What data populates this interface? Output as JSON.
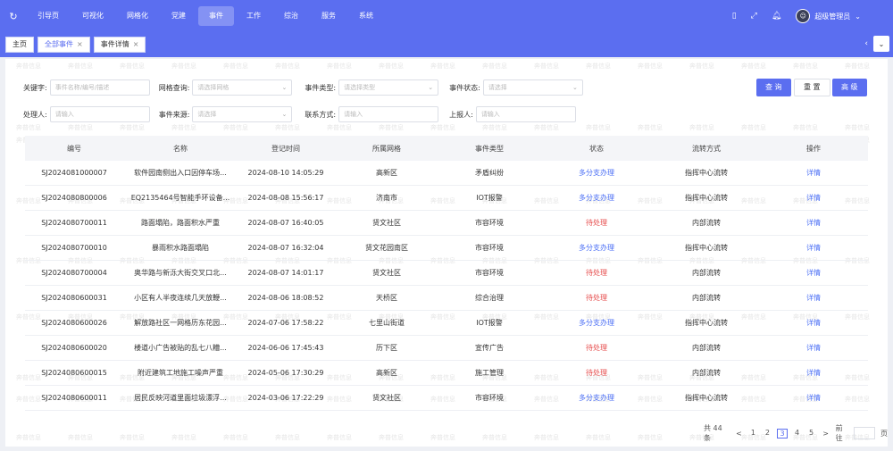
{
  "nav": {
    "items": [
      "引导页",
      "可视化",
      "网格化",
      "党建",
      "事件",
      "工作",
      "综治",
      "服务",
      "系统"
    ],
    "active_index": 4
  },
  "user": {
    "name": "超级管理员"
  },
  "tabs": [
    {
      "label": "主页",
      "closable": false
    },
    {
      "label": "全部事件",
      "closable": true,
      "active": true
    },
    {
      "label": "事件详情",
      "closable": true
    }
  ],
  "watermark": "奔普信息",
  "filters": {
    "keyword": {
      "label": "关键字:",
      "placeholder": "事件名称/编号/描述"
    },
    "grid": {
      "label": "网格查询:",
      "placeholder": "请选择网格"
    },
    "type": {
      "label": "事件类型:",
      "placeholder": "请选择类型"
    },
    "status": {
      "label": "事件状态:",
      "placeholder": "请选择"
    },
    "handler": {
      "label": "处理人:",
      "placeholder": "请输入"
    },
    "source": {
      "label": "事件来源:",
      "placeholder": "请选择"
    },
    "contact": {
      "label": "联系方式:",
      "placeholder": "请输入"
    },
    "reporter": {
      "label": "上报人:",
      "placeholder": "请输入"
    }
  },
  "buttons": {
    "query": "查 询",
    "reset": "重 置",
    "advanced": "高 级"
  },
  "table": {
    "headers": [
      "编号",
      "名称",
      "登记时间",
      "所属网格",
      "事件类型",
      "状态",
      "流转方式",
      "操作"
    ],
    "rows": [
      [
        "SJ2024081000007",
        "软件园南侧出入口因停车场...",
        "2024-08-10 14:05:29",
        "高新区",
        "矛盾纠纷",
        "多分支办理",
        "指挥中心流转",
        "详情"
      ],
      [
        "SJ2024080800006",
        "EQ2135464号智能手环设备...",
        "2024-08-08 15:56:17",
        "济南市",
        "IOT报警",
        "多分支办理",
        "指挥中心流转",
        "详情"
      ],
      [
        "SJ2024080700011",
        "路面塌陷，路面积水严重",
        "2024-08-07 16:40:05",
        "贤文社区",
        "市容环境",
        "待处理",
        "内部流转",
        "详情"
      ],
      [
        "SJ2024080700010",
        "暴雨积水路面塌陷",
        "2024-08-07 16:32:04",
        "贤文花园南区",
        "市容环境",
        "多分支办理",
        "指挥中心流转",
        "详情"
      ],
      [
        "SJ2024080700004",
        "奥华路与新泺大街交叉口北...",
        "2024-08-07 14:01:17",
        "贤文社区",
        "市容环境",
        "待处理",
        "内部流转",
        "详情"
      ],
      [
        "SJ2024080600031",
        "小区有人半夜连续几天放鞭...",
        "2024-08-06 18:08:52",
        "天桥区",
        "综合治理",
        "待处理",
        "内部流转",
        "详情"
      ],
      [
        "SJ2024080600026",
        "解放路社区一网格历东花园...",
        "2024-07-06 17:58:22",
        "七里山街道",
        "IOT报警",
        "多分支办理",
        "指挥中心流转",
        "详情"
      ],
      [
        "SJ2024080600020",
        "楼道小广告被贴的乱七八糟...",
        "2024-06-06 17:45:43",
        "历下区",
        "宣传广告",
        "待处理",
        "内部流转",
        "详情"
      ],
      [
        "SJ2024080600015",
        "附近建筑工地施工噪声严重",
        "2024-05-06 17:30:29",
        "高新区",
        "施工管理",
        "待处理",
        "内部流转",
        "详情"
      ],
      [
        "SJ2024080600011",
        "居民反映河道里面垃圾漂浮...",
        "2024-03-06 17:22:29",
        "贤文社区",
        "市容环境",
        "多分支办理",
        "指挥中心流转",
        "详情"
      ]
    ]
  },
  "pagination": {
    "total_text": "共 44 条",
    "prev": "<",
    "next": ">",
    "pages": [
      "1",
      "2",
      "3",
      "4",
      "5"
    ],
    "current": "3",
    "goto_label": "前往",
    "goto_unit": "页"
  }
}
